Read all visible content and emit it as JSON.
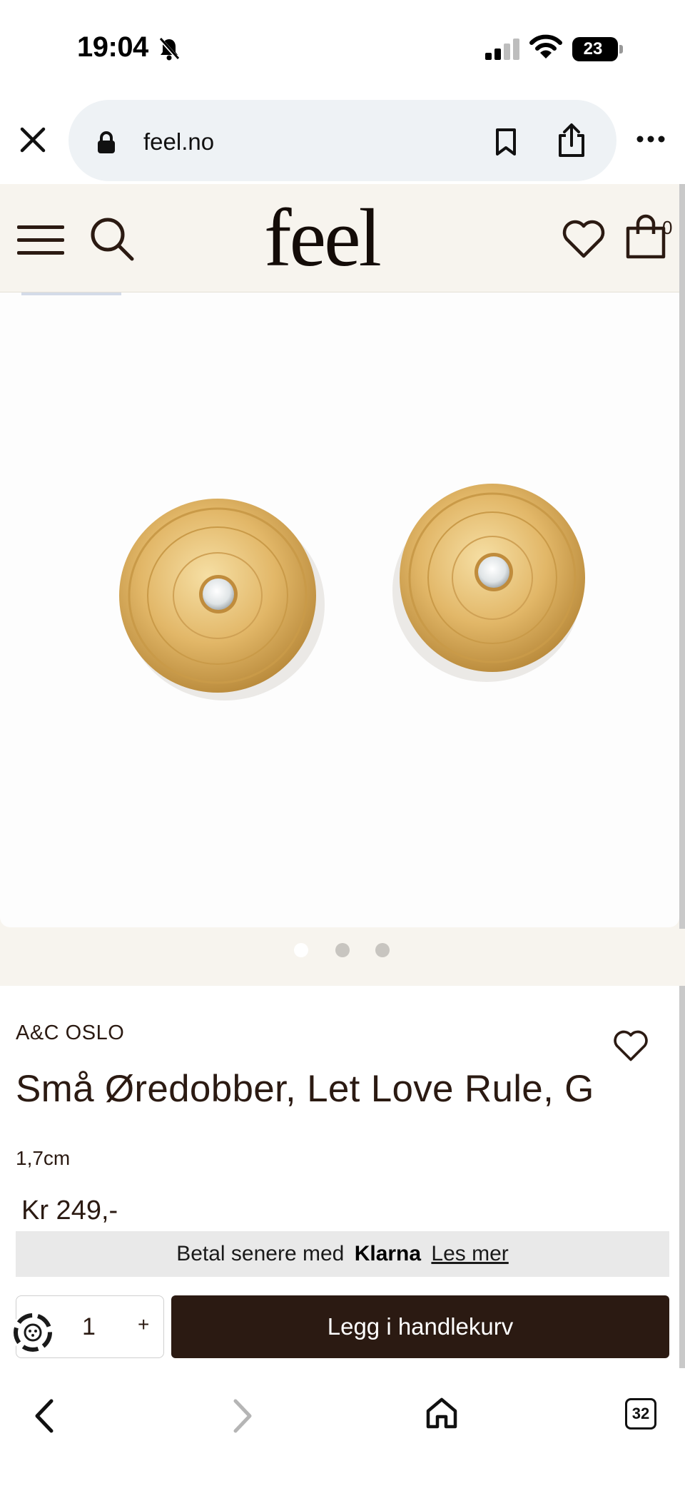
{
  "status_bar": {
    "time": "19:04",
    "battery": "23",
    "icons": [
      "bell-off-icon",
      "signal-icon",
      "wifi-icon",
      "battery-icon"
    ]
  },
  "browser": {
    "url": "feel.no",
    "icons": [
      "close-icon",
      "lock-icon",
      "bookmark-icon",
      "share-icon",
      "more-icon"
    ]
  },
  "site_header": {
    "logo": "feel",
    "cart_count": "0",
    "icons": [
      "menu-icon",
      "search-icon",
      "heart-icon",
      "shopping-bag-icon"
    ]
  },
  "carousel": {
    "total_slides": 3,
    "active_slide": 1
  },
  "product": {
    "brand": "A&C OSLO",
    "title": "Små Øredobber, Let Love Rule, G",
    "size": "1,7cm",
    "price": "Kr 249,-",
    "klarna": {
      "prefix": "Betal senere med",
      "brand": "Klarna",
      "link": "Les mer"
    },
    "quantity": "1",
    "quantity_plus": "+",
    "add_to_cart": "Legg i handlekurv"
  },
  "bottom_bar": {
    "tab_count": "32",
    "icons": [
      "back-icon",
      "forward-icon",
      "home-icon",
      "tabs-icon"
    ]
  },
  "colors": {
    "brand_dark": "#2b1a12",
    "header_bg": "#f7f4ee",
    "url_pill": "#eef2f5",
    "klarna_bar": "#e9e9e9"
  }
}
